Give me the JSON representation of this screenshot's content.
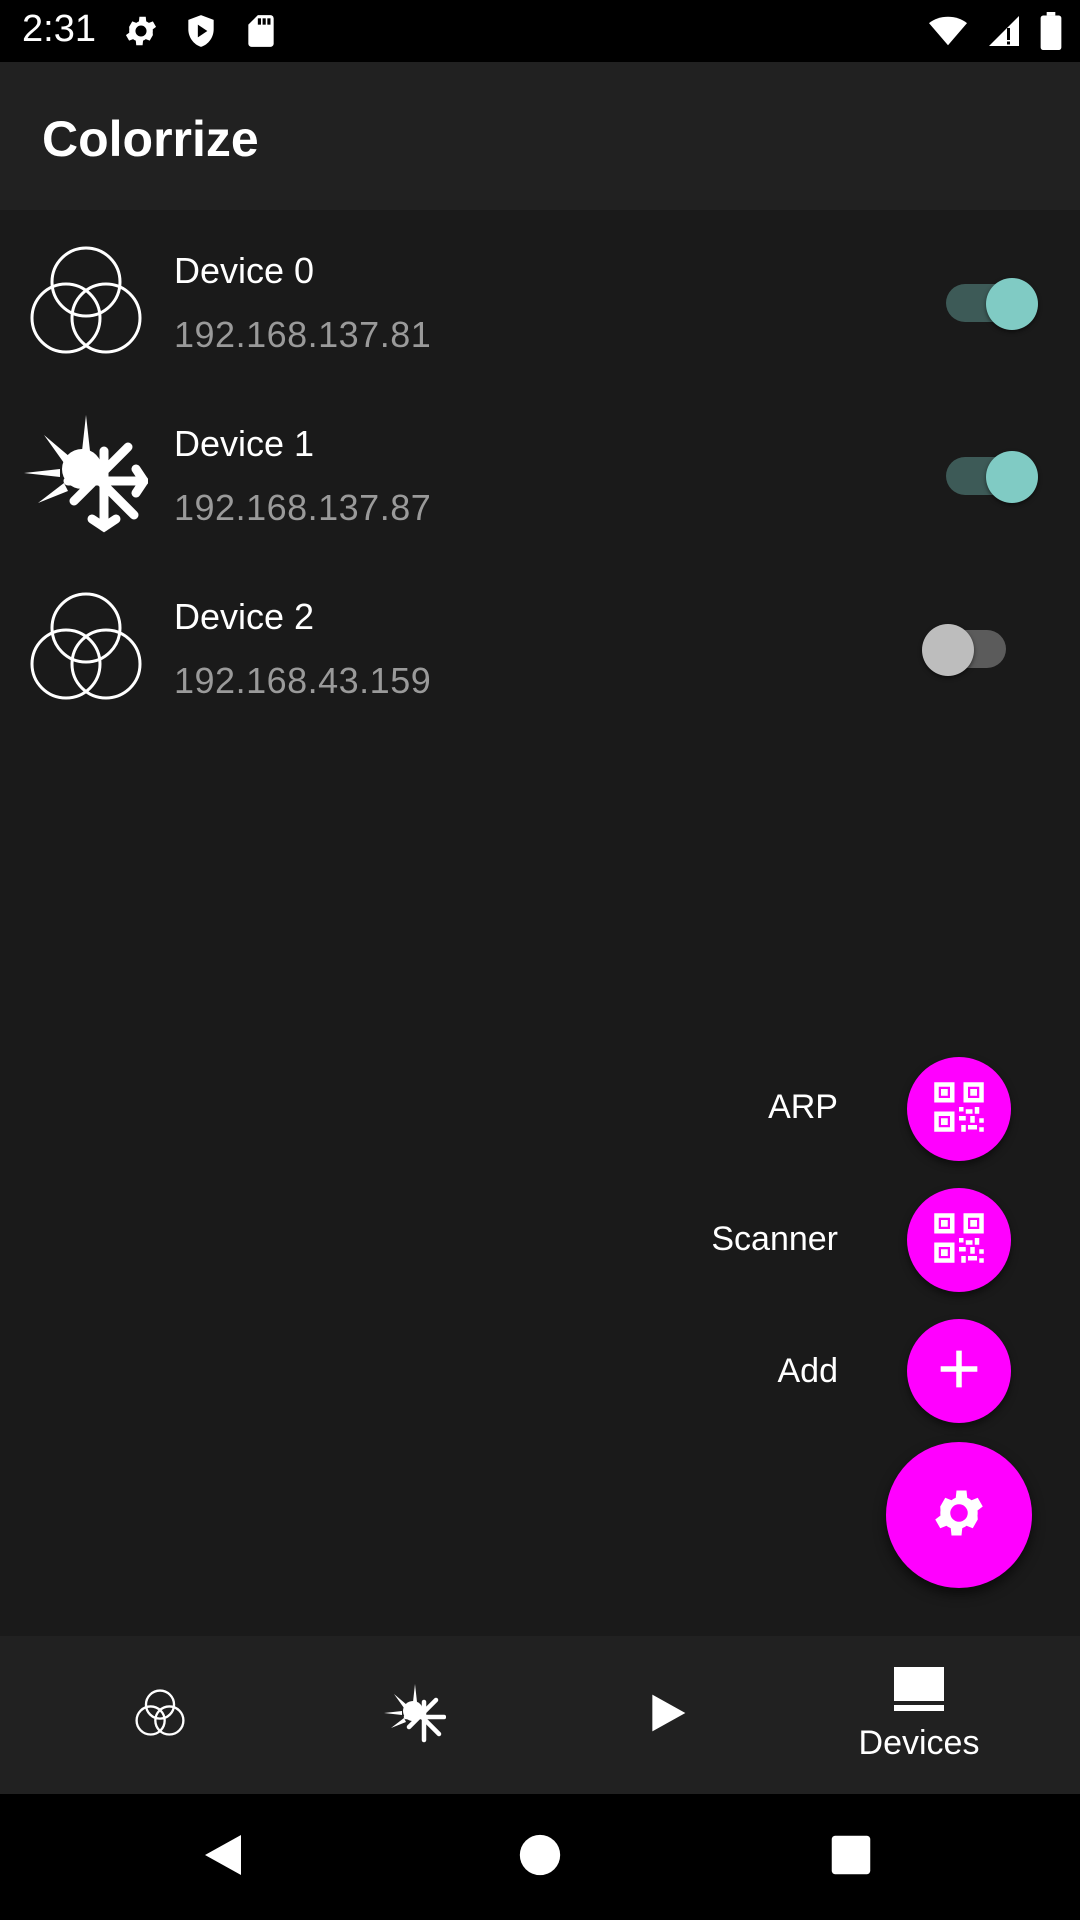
{
  "status_bar": {
    "time": "2:31",
    "left_icons": [
      "settings-icon",
      "shield-icon",
      "sd-card-icon"
    ],
    "right_icons": [
      "wifi-icon",
      "signal-icon",
      "battery-icon"
    ]
  },
  "app_bar": {
    "title": "Colorrize"
  },
  "devices": [
    {
      "name": "Device 0",
      "ip": "192.168.137.81",
      "icon": "rgb-circles-icon",
      "enabled": true
    },
    {
      "name": "Device 1",
      "ip": "192.168.137.87",
      "icon": "sun-snowflake-icon",
      "enabled": true
    },
    {
      "name": "Device 2",
      "ip": "192.168.43.159",
      "icon": "rgb-circles-icon",
      "enabled": false
    }
  ],
  "speed_dial": {
    "actions": [
      {
        "label": "ARP",
        "icon": "qr-code-icon"
      },
      {
        "label": "Scanner",
        "icon": "qr-code-icon"
      },
      {
        "label": "Add",
        "icon": "plus-icon"
      }
    ],
    "main_icon": "gear-icon",
    "color": "#ff00ff"
  },
  "bottom_nav": {
    "items": [
      {
        "icon": "rgb-circles-icon",
        "label": ""
      },
      {
        "icon": "sun-snowflake-icon",
        "label": ""
      },
      {
        "icon": "play-icon",
        "label": ""
      },
      {
        "icon": "devices-icon",
        "label": "Devices",
        "selected": true
      }
    ]
  },
  "system_nav": [
    "back-icon",
    "home-icon",
    "recents-icon"
  ],
  "colors": {
    "accent": "#ff00ff",
    "switch_on": "#80cbc4",
    "background": "#1a1a1a",
    "bar": "#212121"
  }
}
